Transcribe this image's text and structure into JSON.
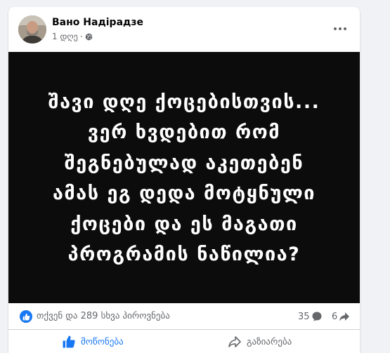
{
  "post": {
    "author_name": "Вано Надірадзе",
    "time": "1 დღე",
    "separator": "·",
    "privacy_icon": "globe-icon",
    "more_icon": "more-options-icon",
    "image_text": "შავი დღე ქოცებისთვის...\nვერ ხვდებით რომ\nშეგნებულად აკეთებენ\nამას ეგ დედა მოტყნული\nქოცები და ეს მაგათი\nპროგრამის ნაწილია?"
  },
  "stats": {
    "reaction_icon": "like-reaction-icon",
    "reactions_text": "თქვენ და 289 სხვა პიროვნება",
    "comments_count": "35",
    "comments_icon": "comment-icon",
    "shares_count": "6",
    "shares_icon": "share-icon"
  },
  "actions": {
    "like_label": "მოწონება",
    "like_icon": "thumbs-up-icon",
    "share_label": "გაზიარება",
    "share_icon": "share-arrow-icon"
  },
  "colors": {
    "accent": "#1877f2",
    "secondary_text": "#65676b",
    "image_background": "#0c0c0c",
    "page_background": "#f0f2f5"
  }
}
